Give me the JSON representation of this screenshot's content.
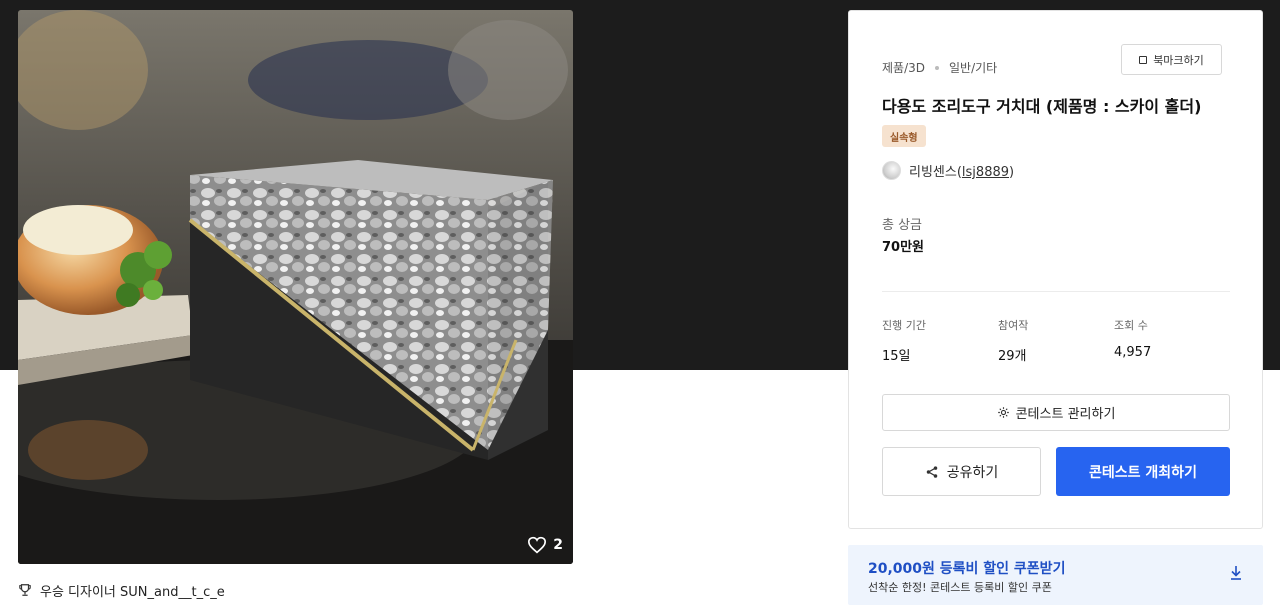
{
  "image": {
    "likes": "2",
    "colors": {
      "heart": "#ffffff"
    }
  },
  "winner": {
    "label": "우승 디자이너 SUN_and__t_c_e"
  },
  "panel": {
    "category": "제품/3D",
    "subcategory": "일반/기타",
    "bookmark_label": "북마크하기",
    "title": "다용도 조리도구 거치대 (제품명 : 스카이 홀더)",
    "type_badge": "실속형",
    "host_name": "리빙센스",
    "host_id": "lsj8889",
    "prize_label": "총 상금",
    "prize_value": "70만원",
    "stats": [
      {
        "label": "진행 기간",
        "value": "15일"
      },
      {
        "label": "참여작",
        "value": "29개"
      },
      {
        "label": "조회 수",
        "value": "4,957"
      }
    ],
    "manage_label": "콘테스트 관리하기",
    "share_label": "공유하기",
    "host_contest_label": "콘테스트 개최하기"
  },
  "coupon": {
    "title": "20,000원 등록비 할인 쿠폰받기",
    "subtitle": "선착순 한정! 콘테스트 등록비 할인 쿠폰"
  },
  "colors": {
    "primary": "#2764f0",
    "coupon_bg": "#eef4fd",
    "coupon_title": "#1f4fc4",
    "badge_bg": "#f6e2cf",
    "badge_text": "#9a5a2a"
  }
}
